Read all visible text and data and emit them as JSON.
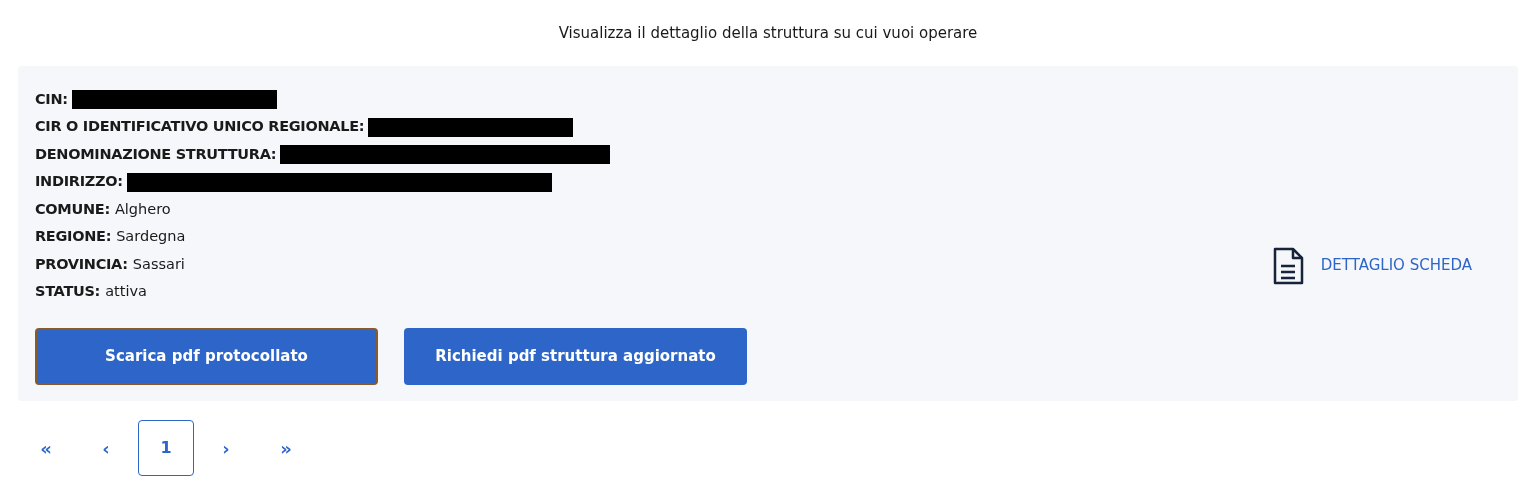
{
  "heading": "Visualizza il dettaglio della struttura su cui vuoi operare",
  "fields": [
    {
      "label": "CIN:",
      "redacted": true
    },
    {
      "label": "CIR O IDENTIFICATIVO UNICO REGIONALE:",
      "redacted": true
    },
    {
      "label": "DENOMINAZIONE STRUTTURA:",
      "redacted": true
    },
    {
      "label": "INDIRIZZO:",
      "redacted": true
    },
    {
      "label": "COMUNE:",
      "value": "Alghero",
      "redacted": false
    },
    {
      "label": "REGIONE:",
      "value": "Sardegna",
      "redacted": false
    },
    {
      "label": "PROVINCIA:",
      "value": "Sassari",
      "redacted": false
    },
    {
      "label": "STATUS:",
      "value": "attiva",
      "redacted": false
    }
  ],
  "buttons": [
    {
      "label": "Scarica pdf protocollato",
      "focused": true
    },
    {
      "label": "Richiedi pdf struttura aggiornato",
      "focused": false
    }
  ],
  "detail_link": "DETTAGLIO SCHEDA",
  "pagination": [
    {
      "kind": "first",
      "label": "«",
      "selected": false
    },
    {
      "kind": "prev",
      "label": "‹",
      "selected": false
    },
    {
      "kind": "page",
      "label": "1",
      "selected": true
    },
    {
      "kind": "next",
      "label": "›",
      "selected": false
    },
    {
      "kind": "last",
      "label": "»",
      "selected": false
    }
  ]
}
